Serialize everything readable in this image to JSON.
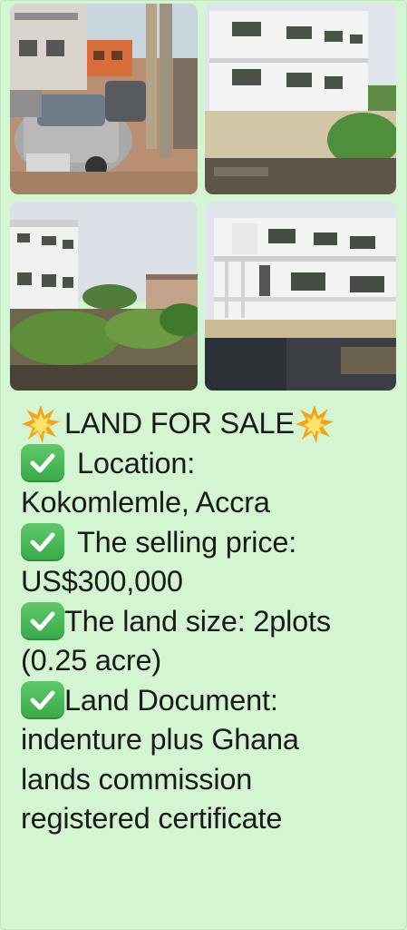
{
  "post": {
    "photos": [
      {
        "caption": "street-with-parked-car"
      },
      {
        "caption": "white-two-storey-building-behind-wall"
      },
      {
        "caption": "overgrown-land-plot"
      },
      {
        "caption": "white-building-with-balconies"
      }
    ],
    "headline": "LAND FOR SALE",
    "items": [
      {
        "icon": "check-mark-icon",
        "line1": "Location:",
        "line2": "Kokomlemle, Accra"
      },
      {
        "icon": "check-mark-icon",
        "line1": "The selling price:",
        "line2": "US$300,000"
      },
      {
        "icon": "check-mark-icon",
        "line1": "The land size: 2plots",
        "line2": "(0.25 acre)"
      },
      {
        "icon": "check-mark-icon",
        "line1": "Land Document:",
        "line2": "indenture plus Ghana",
        "line3": "lands commission",
        "line4": "registered certificate"
      }
    ],
    "colors": {
      "background": "#d3f5d1",
      "check": "#43b14f",
      "burst": "#f6a21a"
    }
  }
}
